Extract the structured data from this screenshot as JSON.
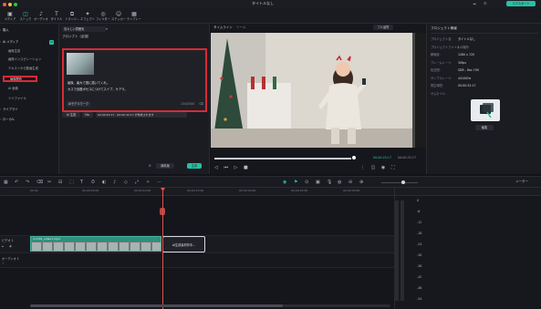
{
  "window": {
    "title": "タイトルなし",
    "export_label": "エクスポート"
  },
  "ribbon": {
    "tools": [
      {
        "icon": "media-icon",
        "glyph": "▣",
        "label": "メディア"
      },
      {
        "icon": "stock-icon",
        "glyph": "◫",
        "label": "ストック"
      },
      {
        "icon": "audio-icon",
        "glyph": "♪",
        "label": "オーディオ"
      },
      {
        "icon": "title-icon",
        "glyph": "T",
        "label": "タイトル"
      },
      {
        "icon": "transition-icon",
        "glyph": "⧉",
        "label": "トランジ..."
      },
      {
        "icon": "effect-icon",
        "glyph": "✦",
        "label": "エフェクト"
      },
      {
        "icon": "filter-icon",
        "glyph": "◎",
        "label": "フィルター"
      },
      {
        "icon": "sticker-icon",
        "glyph": "☺",
        "label": "ステッカー"
      },
      {
        "icon": "template-icon",
        "glyph": "▦",
        "label": "テンプレート"
      }
    ]
  },
  "left_panel": {
    "items": [
      {
        "label": "購入",
        "bold": true
      },
      {
        "label": "AI メディア",
        "bold": true,
        "badge": "AI"
      },
      {
        "label": "画像生成"
      },
      {
        "label": "画像インスピレーション"
      },
      {
        "label": "テキストから動画生成"
      },
      {
        "label": "画像配布",
        "highlight": true
      },
      {
        "label": "AI 画像"
      },
      {
        "label": "ツイファイル"
      },
      {
        "label": "ライブラリ",
        "bold": true
      },
      {
        "label": "ローカル",
        "bold": true
      }
    ]
  },
  "prompt_panel": {
    "style_select": "清々しい雰囲気",
    "prompt_label": "プロンプト（必須）",
    "prompt_line1": "最後、最大で選に描いてくれ。",
    "prompt_line2": "カスで出題ポセスにつけてスイブ，ケアラ。",
    "detail_btn": "AIモデルマーク",
    "char_count": "134/2000",
    "tag1": "AI 生成",
    "tag2": "No.",
    "time_range": "00:00:25:17 - 00:00:32:17 が作成されます",
    "credit_label": "無料版",
    "generate_label": "生成"
  },
  "preview": {
    "tab_timeline": "タイムライン",
    "tab_tools": "ツール",
    "quality": "フル品質",
    "time_current": "00:00:25:17",
    "time_total": "00:00:32:17"
  },
  "properties": {
    "title": "プロジェクト情報",
    "rows": [
      {
        "k": "プロジェクト名:",
        "v": "タイトルなし"
      },
      {
        "k": "プロジェクトファイルの場所:",
        "v": "/"
      },
      {
        "k": "解像度:",
        "v": "1280 x 720"
      },
      {
        "k": "フレームレート:",
        "v": "30fps"
      },
      {
        "k": "色空間:",
        "v": "SDR - Rec.709"
      },
      {
        "k": "サンプルレート:",
        "v": "44100Hz"
      },
      {
        "k": "再生時間:",
        "v": "00:00:32:17"
      },
      {
        "k": "サムネイル:",
        "v": ""
      }
    ],
    "edit_label": "編集"
  },
  "timeline": {
    "ruler": [
      "00:00",
      "00:00:05:00",
      "00:00:10:00",
      "00:00:15:00",
      "00:00:20:00",
      "00:00:25:00",
      "00:00:30:00"
    ],
    "clip_label": "4.1181_video1.mp4",
    "gen_label": "AI生成素材作中...",
    "track_video": "ビデオ 1",
    "track_audio": "オーディオ 1",
    "meter_ticks": [
      "0",
      "-6",
      "-12",
      "-18",
      "-24",
      "-30",
      "-36",
      "-42",
      "-48",
      "-54"
    ],
    "zoom_label": "メーター"
  },
  "colors": {
    "accent": "#27c0a5",
    "highlight": "#d92a35",
    "playhead": "#e0534e",
    "clip": "#2f8f7e"
  }
}
